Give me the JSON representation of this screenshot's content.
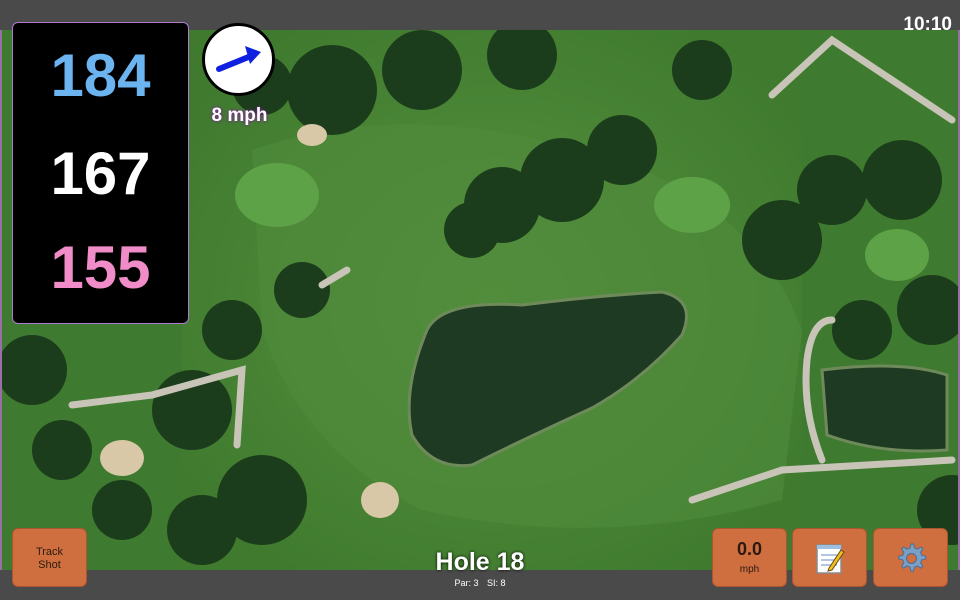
{
  "status": {
    "time": "10:10"
  },
  "distances": {
    "back": "184",
    "middle": "167",
    "front": "155"
  },
  "wind": {
    "speed": "8 mph",
    "icon": "wind-arrow-icon"
  },
  "hole": {
    "title": "Hole 18",
    "par": "Par: 3",
    "si": "SI: 8"
  },
  "buttons": {
    "track_shot_line1": "Track",
    "track_shot_line2": "Shot",
    "speed_value": "0.0",
    "speed_unit": "mph",
    "notes_icon": "notepad-icon",
    "settings_icon": "gear-icon"
  },
  "colors": {
    "back": "#6cb4f0",
    "middle": "#ffffff",
    "front": "#f08cc8",
    "button": "#cf6f3f",
    "wind_text": "#ffffff"
  }
}
